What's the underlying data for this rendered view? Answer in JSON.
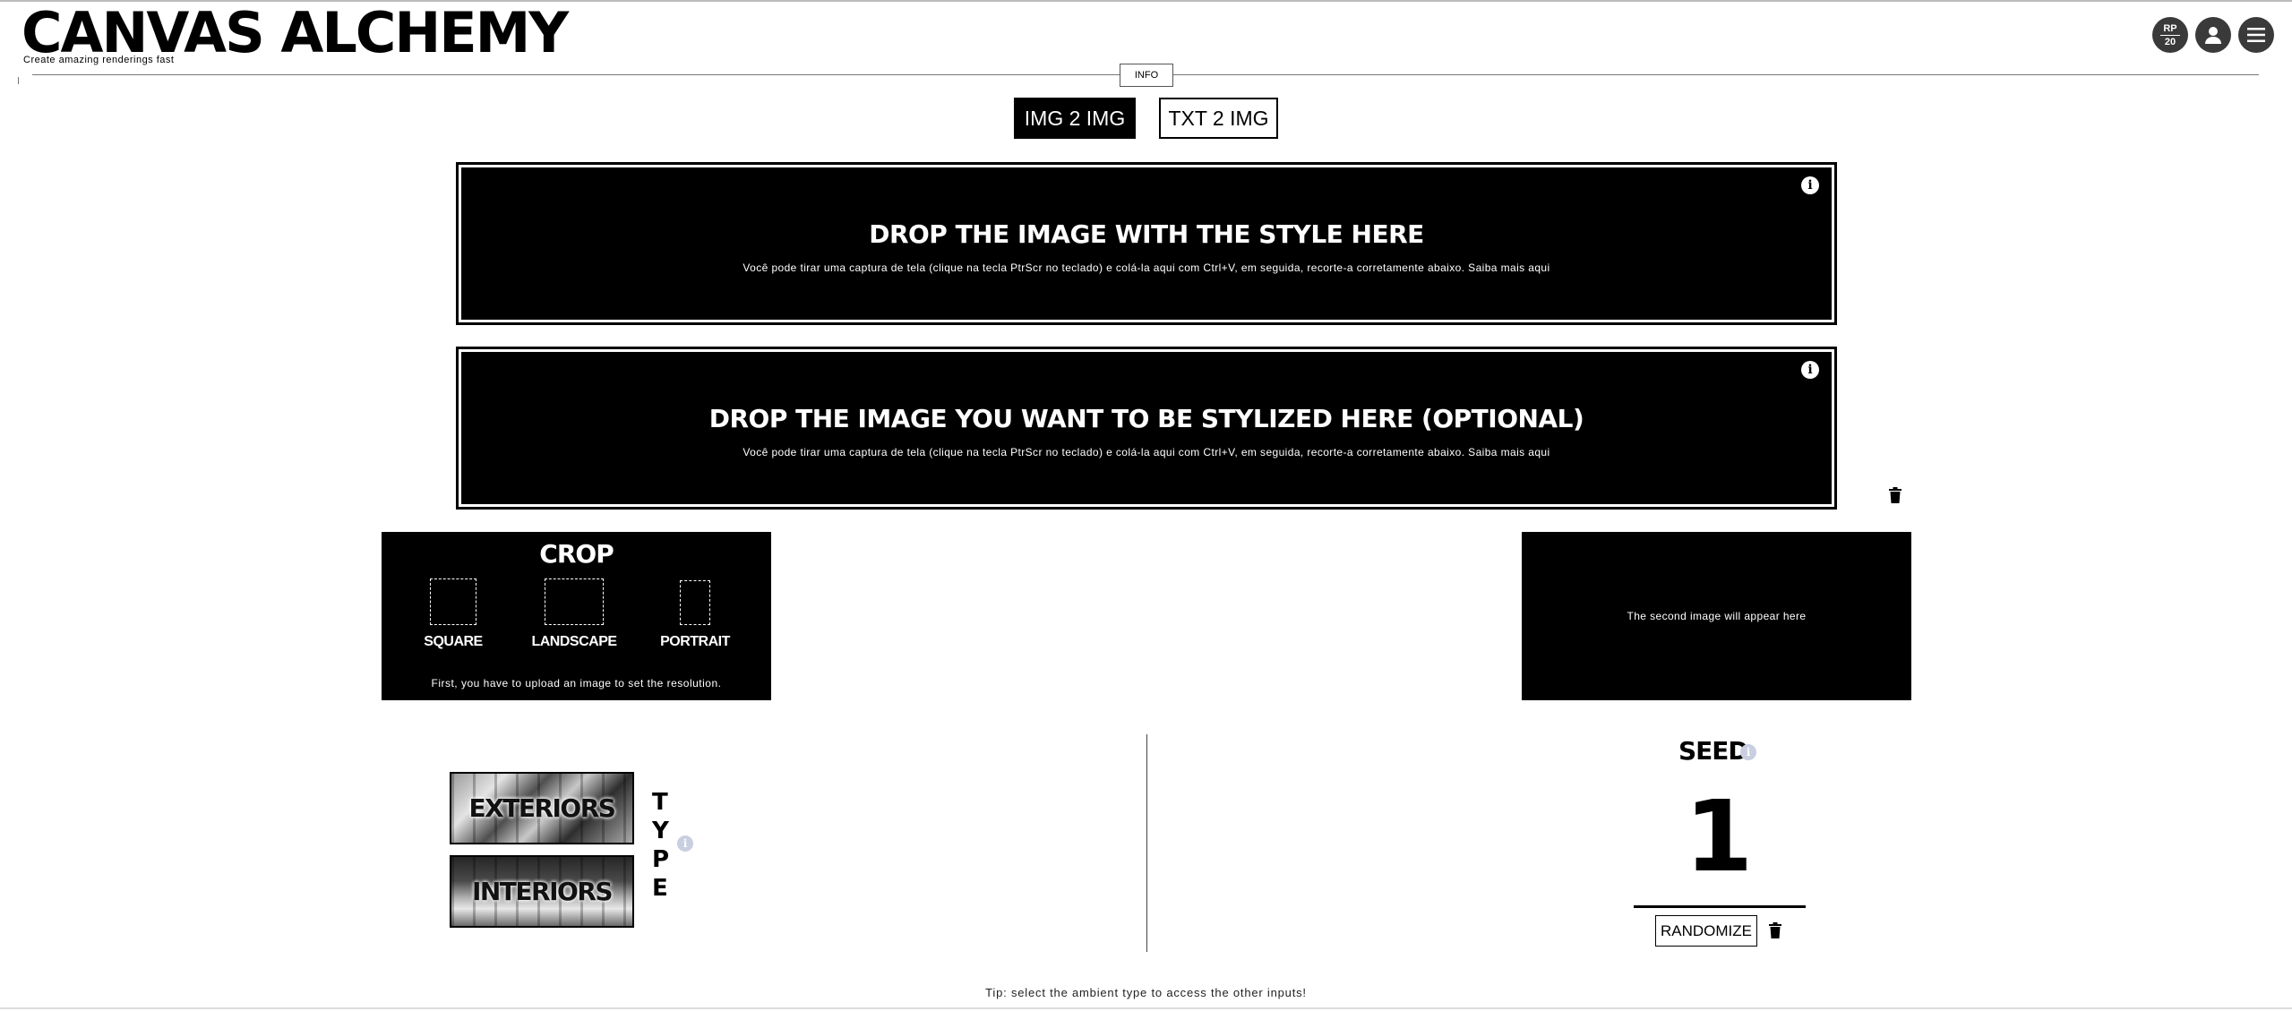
{
  "header": {
    "logo": "CANVAS ALCHEMY",
    "tagline": "Create amazing renderings fast",
    "info_label": "INFO",
    "credits_top": "RP",
    "credits_bottom": "20",
    "icons": [
      "user-icon",
      "hamburger-menu-icon"
    ]
  },
  "mode_tabs": [
    {
      "label": "IMG 2 IMG",
      "active": true
    },
    {
      "label": "TXT 2 IMG",
      "active": false
    }
  ],
  "dropzones": {
    "style": {
      "title": "DROP THE IMAGE WITH THE STYLE HERE",
      "subtitle": "Você pode tirar uma captura de tela (clique na tecla PtrScr no teclado) e colá-la aqui com Ctrl+V, em seguida, recorte-a corretamente abaixo. Saiba mais aqui"
    },
    "target": {
      "title": "DROP THE IMAGE YOU WANT TO BE STYLIZED HERE (OPTIONAL)",
      "subtitle": "Você pode tirar uma captura de tela (clique na tecla PtrScr no teclado) e colá-la aqui com Ctrl+V, em seguida, recorte-a corretamente abaixo. Saiba mais aqui"
    }
  },
  "crop": {
    "title": "CROP",
    "options": [
      "SQUARE",
      "LANDSCAPE",
      "PORTRAIT"
    ],
    "note": "First, you have to upload an image to set the resolution."
  },
  "second_preview": {
    "placeholder": "The second image will appear here"
  },
  "ambient_type": {
    "label": "TYPE",
    "letters": [
      "T",
      "Y",
      "P",
      "E"
    ],
    "options": [
      "EXTERIORS",
      "INTERIORS"
    ]
  },
  "seed": {
    "title": "SEED",
    "value": "1",
    "randomize_label": "RANDOMIZE"
  },
  "tip": "Tip: select the ambient type to access the other inputs!"
}
